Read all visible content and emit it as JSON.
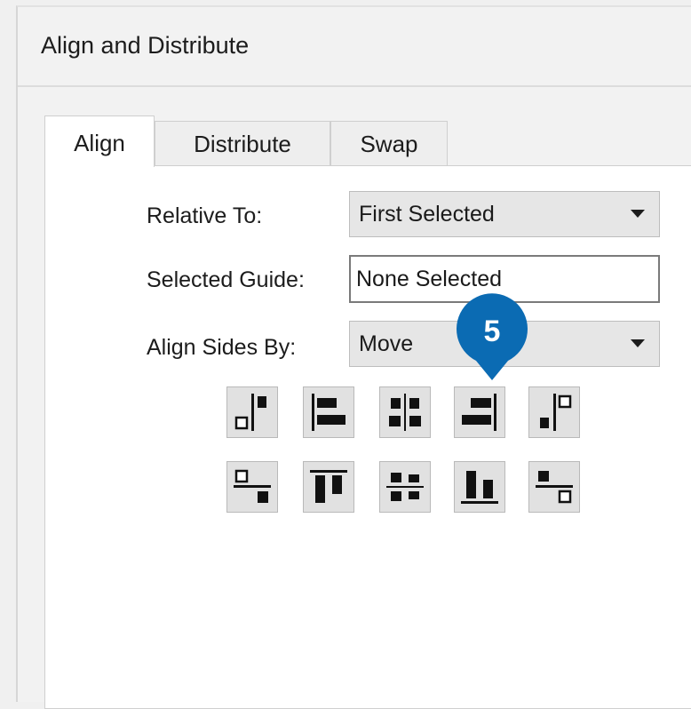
{
  "window": {
    "title": "Align and Distribute"
  },
  "tabs": [
    {
      "label": "Align",
      "active": true
    },
    {
      "label": "Distribute",
      "active": false
    },
    {
      "label": "Swap",
      "active": false
    }
  ],
  "form": {
    "relative_to": {
      "label": "Relative To:",
      "value": "First Selected"
    },
    "selected_guide": {
      "label": "Selected Guide:",
      "value": "None Selected"
    },
    "align_sides_by": {
      "label": "Align Sides By:",
      "value": "Move"
    }
  },
  "callout": {
    "number": "5",
    "color": "#0b6bb3"
  },
  "align_buttons": [
    {
      "icon": "align-left-to-right-icon"
    },
    {
      "icon": "align-left-edges-icon"
    },
    {
      "icon": "align-horizontal-centers-icon"
    },
    {
      "icon": "align-right-edges-icon"
    },
    {
      "icon": "align-right-to-left-icon"
    },
    {
      "icon": "align-top-to-bottom-icon"
    },
    {
      "icon": "align-top-edges-icon"
    },
    {
      "icon": "align-vertical-centers-icon"
    },
    {
      "icon": "align-bottom-edges-icon"
    },
    {
      "icon": "align-bottom-to-top-icon"
    }
  ]
}
